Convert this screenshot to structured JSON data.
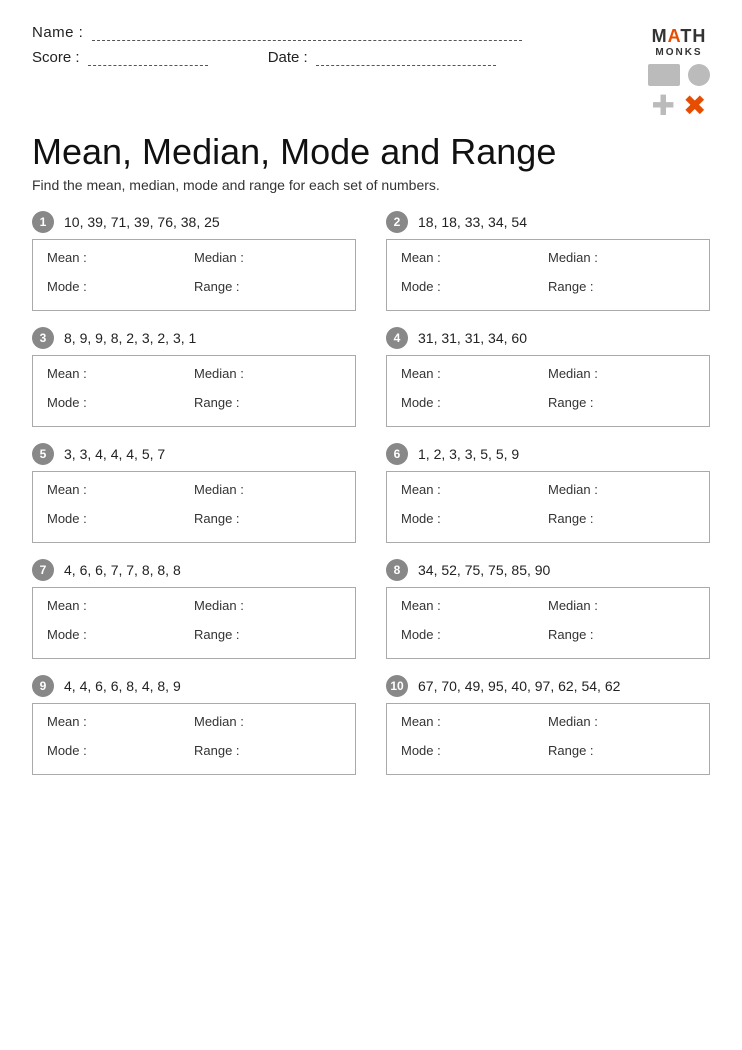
{
  "header": {
    "name_label": "Name :",
    "score_label": "Score :",
    "date_label": "Date :",
    "logo_line1_part1": "M",
    "logo_line1_highlight": "A",
    "logo_line1_part2": "TH",
    "logo_line2": "MONKS"
  },
  "title": "Mean, Median, Mode and Range",
  "subtitle": "Find the mean, median, mode and range for each set of numbers.",
  "problems": [
    {
      "num": "1",
      "numbers": "10, 39, 71, 39, 76, 38, 25"
    },
    {
      "num": "2",
      "numbers": "18, 18, 33, 34, 54"
    },
    {
      "num": "3",
      "numbers": "8, 9, 9, 8, 2, 3, 2, 3, 1"
    },
    {
      "num": "4",
      "numbers": "31, 31, 31, 34, 60"
    },
    {
      "num": "5",
      "numbers": "3, 3, 4, 4, 4, 5, 7"
    },
    {
      "num": "6",
      "numbers": "1, 2, 3, 3, 5, 5, 9"
    },
    {
      "num": "7",
      "numbers": "4, 6, 6, 7, 7, 8, 8, 8"
    },
    {
      "num": "8",
      "numbers": "34, 52, 75, 75, 85, 90"
    },
    {
      "num": "9",
      "numbers": "4, 4, 6, 6, 8, 4, 8, 9"
    },
    {
      "num": "10",
      "numbers": "67, 70, 49, 95, 40, 97, 62, 54, 62"
    }
  ],
  "answer_labels": {
    "mean": "Mean :",
    "median": "Median :",
    "mode": "Mode :",
    "range": "Range :"
  }
}
